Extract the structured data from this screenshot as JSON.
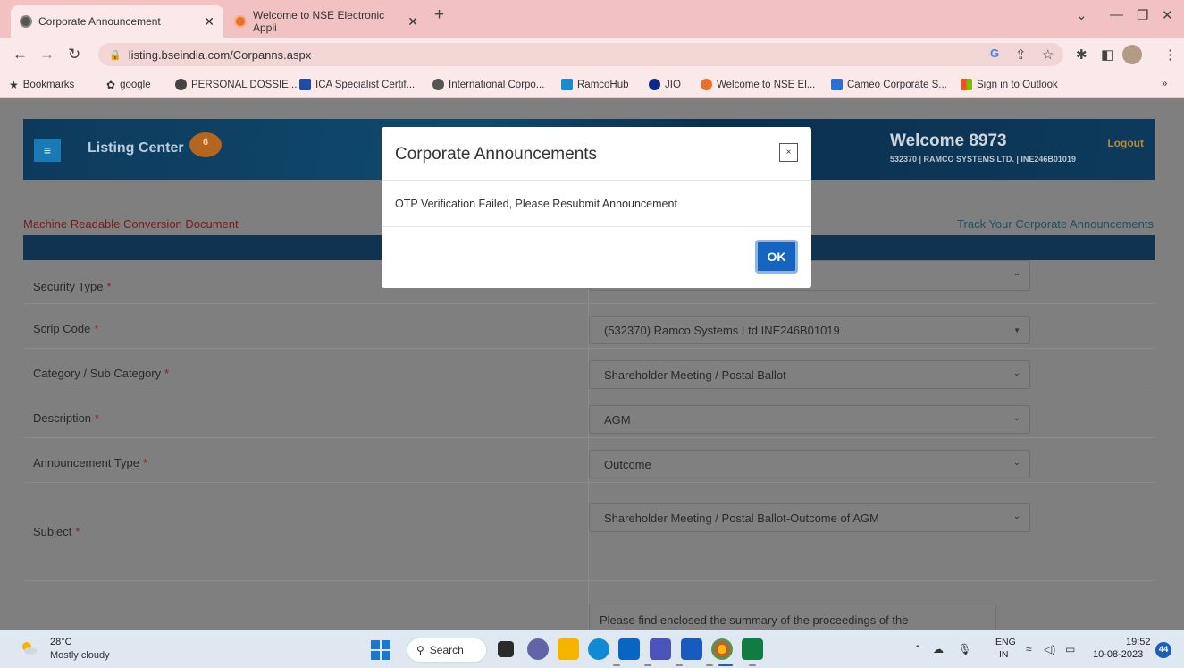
{
  "browser": {
    "tabs": [
      {
        "title": "Corporate Announcement",
        "icon": "globe-icon",
        "active": true
      },
      {
        "title": "Welcome to NSE Electronic Appli",
        "icon": "nse-icon",
        "active": false
      }
    ],
    "new_tab": "+",
    "url": "listing.bseindia.com/Corpanns.aspx",
    "bookmarks": [
      {
        "label": "Bookmarks",
        "icon": "star-icon"
      },
      {
        "label": "google",
        "icon": "gear-icon"
      },
      {
        "label": "PERSONAL DOSSIE...",
        "icon": "globe-icon"
      },
      {
        "label": "ICA Specialist Certif...",
        "icon": "ica-icon"
      },
      {
        "label": "International Corpo...",
        "icon": "crest-icon"
      },
      {
        "label": "RamcoHub",
        "icon": "ramco-icon"
      },
      {
        "label": "JIO",
        "icon": "jio-icon"
      },
      {
        "label": "Welcome to NSE El...",
        "icon": "nse-icon"
      },
      {
        "label": "Cameo Corporate S...",
        "icon": "cameo-icon"
      },
      {
        "label": "Sign in to Outlook",
        "icon": "ms-icon"
      }
    ],
    "more": "»"
  },
  "header": {
    "menu_icon": "menu-icon",
    "title": "Listing Center",
    "badge": "6",
    "welcome": "Welcome 8973",
    "logout": "Logout",
    "company": "532370 | RAMCO SYSTEMS LTD. | INE246B01019"
  },
  "links": {
    "mrc": "Machine Readable Conversion Document",
    "track": "Track Your Corporate Announcements"
  },
  "form": {
    "rows": [
      {
        "label": "Security Type",
        "value": ""
      },
      {
        "label": "Scrip Code",
        "value": "(532370) Ramco Systems Ltd INE246B01019"
      },
      {
        "label": "Category / Sub Category",
        "value": "Shareholder Meeting / Postal Ballot"
      },
      {
        "label": "Description",
        "value": "AGM"
      },
      {
        "label": "Announcement Type",
        "value": "Outcome"
      },
      {
        "label": "Subject",
        "value": "Shareholder Meeting / Postal Ballot-Outcome of AGM"
      }
    ],
    "required_mark": "*",
    "summary_text": "Please find enclosed the summary of the proceedings of the"
  },
  "modal": {
    "title": "Corporate Announcements",
    "close": "×",
    "message": "OTP Verification Failed, Please Resubmit Announcement",
    "ok": "OK"
  },
  "taskbar": {
    "temperature": "28°C",
    "weather": "Mostly cloudy",
    "search": "Search",
    "lang1": "ENG",
    "lang2": "IN",
    "time": "19:52",
    "date": "10-08-2023",
    "notifications": "44"
  }
}
